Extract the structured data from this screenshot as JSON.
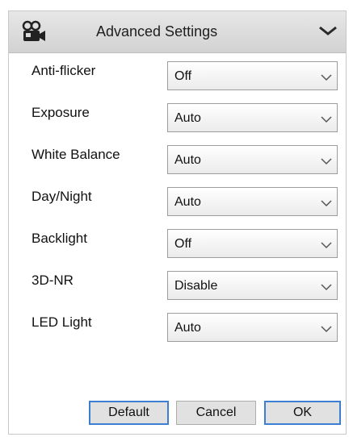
{
  "header": {
    "title": "Advanced Settings",
    "icon": "camera-icon",
    "collapse_icon": "chevron-down-icon"
  },
  "settings": [
    {
      "key": "anti_flicker",
      "label": "Anti-flicker",
      "value": "Off"
    },
    {
      "key": "exposure",
      "label": "Exposure",
      "value": "Auto"
    },
    {
      "key": "white_balance",
      "label": "White Balance",
      "value": "Auto"
    },
    {
      "key": "day_night",
      "label": "Day/Night",
      "value": "Auto"
    },
    {
      "key": "backlight",
      "label": "Backlight",
      "value": "Off"
    },
    {
      "key": "three_d_nr",
      "label": "3D-NR",
      "value": "Disable"
    },
    {
      "key": "led_light",
      "label": "LED Light",
      "value": "Auto"
    }
  ],
  "buttons": {
    "default_label": "Default",
    "cancel_label": "Cancel",
    "ok_label": "OK"
  },
  "colors": {
    "accent": "#3c7fd1",
    "header_bg": "#d9d9d9"
  }
}
